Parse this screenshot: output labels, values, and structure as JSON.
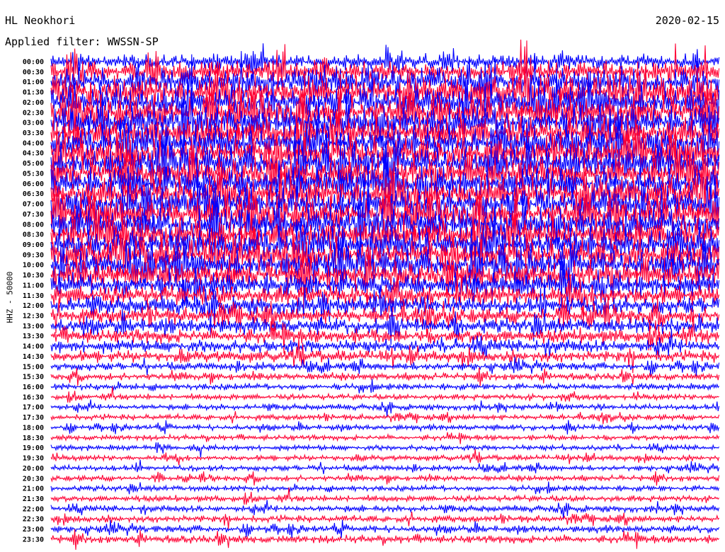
{
  "header": {
    "station": "HL Neokhori",
    "date": "2020-02-15",
    "filter": "Applied filter: WWSSN-SP"
  },
  "chart_data": {
    "type": "line",
    "ylabel": "HHZ - 50000",
    "row_labels": [
      "00:00",
      "00:30",
      "01:00",
      "01:30",
      "02:00",
      "02:30",
      "03:00",
      "03:30",
      "04:00",
      "04:30",
      "05:00",
      "05:30",
      "06:00",
      "06:30",
      "07:00",
      "07:30",
      "08:00",
      "08:30",
      "09:00",
      "09:30",
      "10:00",
      "10:30",
      "11:00",
      "11:30",
      "12:00",
      "12:30",
      "13:00",
      "13:30",
      "14:00",
      "14:30",
      "15:00",
      "15:30",
      "16:00",
      "16:30",
      "17:00",
      "17:30",
      "18:00",
      "18:30",
      "19:00",
      "19:30",
      "20:00",
      "20:30",
      "21:00",
      "21:30",
      "22:00",
      "22:30",
      "23:00",
      "23:30"
    ],
    "series_colors": [
      "#0000ff",
      "#ff0033"
    ],
    "row_amplitude": [
      0.9,
      1.2,
      1.6,
      1.9,
      2.0,
      2.0,
      2.0,
      2.0,
      2.0,
      2.0,
      2.0,
      2.0,
      2.0,
      2.0,
      2.0,
      2.0,
      2.0,
      2.0,
      2.0,
      1.9,
      1.8,
      1.7,
      1.5,
      1.3,
      1.1,
      1.0,
      0.95,
      0.9,
      0.8,
      0.7,
      0.5,
      0.45,
      0.4,
      0.35,
      0.35,
      0.35,
      0.35,
      0.33,
      0.33,
      0.33,
      0.35,
      0.35,
      0.35,
      0.38,
      0.4,
      0.42,
      0.45,
      0.5
    ],
    "grid": false,
    "legend": "none"
  }
}
